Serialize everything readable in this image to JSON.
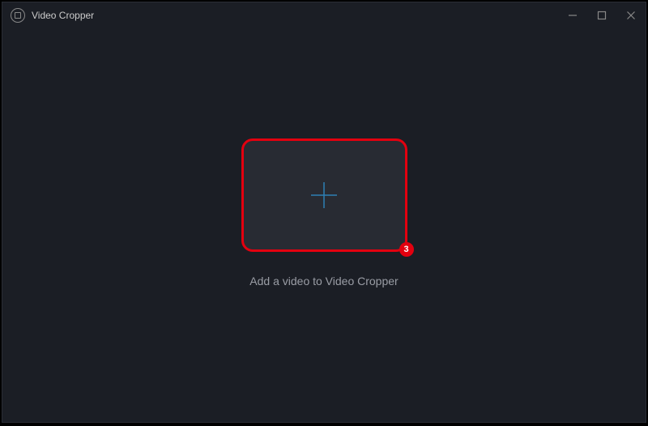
{
  "window": {
    "title": "Video Cropper"
  },
  "main": {
    "instruction": "Add a video to Video Cropper",
    "step_number": "3"
  }
}
